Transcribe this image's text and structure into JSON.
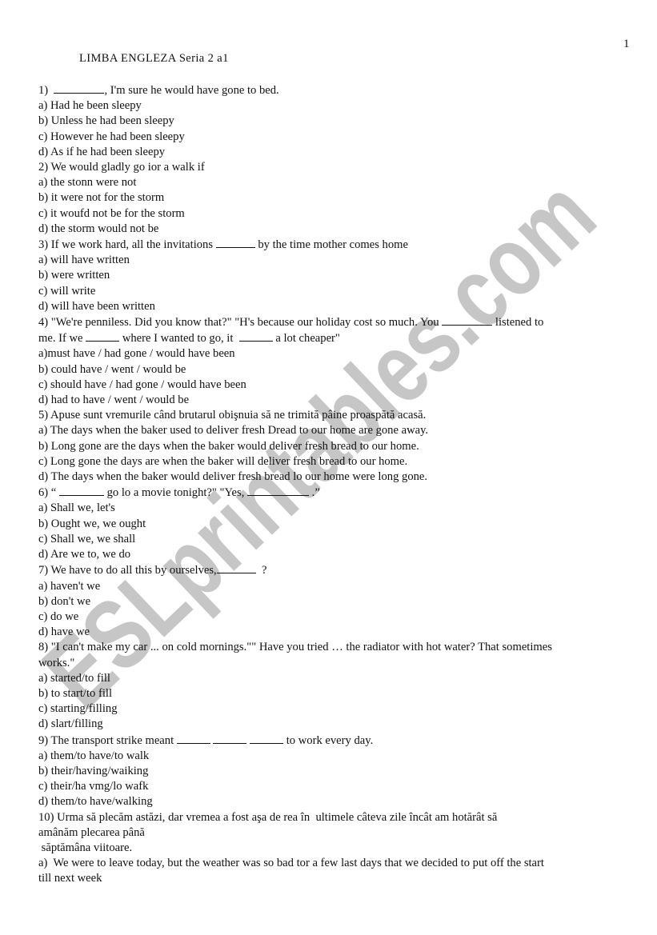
{
  "page": {
    "number": "1",
    "title": "LIMBA ENGLEZA Seria 2 a1",
    "watermark": "ESLprintables.com",
    "watermark_color": "#c6c6c6"
  },
  "questions": [
    {
      "lines": [
        {
          "parts": [
            "1)  ",
            {
              "blank": "_________"
            },
            ", I'm sure he would have gone to bed."
          ]
        }
      ],
      "options": [
        "a) Had he been sleepy",
        "b) Unless he had been sleepy",
        "c) However he had been sleepy",
        "d) As if he had been sleepy"
      ]
    },
    {
      "lines": [
        {
          "parts": [
            "2) We would gladly go ior a walk if"
          ]
        }
      ],
      "options": [
        "a) the stonn were not",
        "b) it were not for the storm",
        "c) it woufd not be for the storm",
        "d) the storm would not be"
      ]
    },
    {
      "lines": [
        {
          "parts": [
            "3) If we work hard, all the invitations ",
            {
              "blank": "_______"
            },
            " by the time mother comes home"
          ]
        }
      ],
      "options": [
        "a) will have written",
        "b) were written",
        "c) will write",
        "d) will have been written"
      ]
    },
    {
      "lines": [
        {
          "parts": [
            "4) \"We're penniless. Did you know that?\" \"H's because our holiday cost so much. You ",
            {
              "blank": "_________"
            },
            " listened to"
          ]
        },
        {
          "parts": [
            "me. If we ",
            {
              "blank": "______"
            },
            " where I wanted to go, it  ",
            {
              "blank": "______"
            },
            " a lot cheaper\""
          ]
        }
      ],
      "options": [
        "a)must have / had gone / would have been",
        "b) could have / went / would be",
        "c) should have / had gone / would have been",
        "d) had to have / went / would be"
      ]
    },
    {
      "lines": [
        {
          "parts": [
            "5) Apuse sunt vremurile când brutarul obişnuia să ne trimită pâine proaspătă acasă."
          ]
        }
      ],
      "options": [
        "a) The days when the baker used to deliver fresh Dread to our home are gone away.",
        "b) Long gone are the days when the baker would deliver fresh bread to our home.",
        "c) Long gone the days are when the baker will deliver fresh bread to our home.",
        "d) The days when the baker would deliver fresh bread lo our home were long gone."
      ]
    },
    {
      "lines": [
        {
          "parts": [
            "6) “ ",
            {
              "blank": "________"
            },
            " go lo a movie tonight?\" \"Yes, ",
            {
              "blank": "___________"
            },
            " .”"
          ]
        }
      ],
      "options": [
        "a) Shall we, let's",
        "b) Ought we, we ought",
        "c) Shall we, we shall",
        "d) Are we to, we do"
      ]
    },
    {
      "lines": [
        {
          "parts": [
            "7) We have to do all this by ourselves,",
            {
              "blank": "_______"
            },
            "  ?"
          ]
        }
      ],
      "options": [
        "a) haven't we",
        "b) don't we",
        "c) do we",
        "d) have we"
      ]
    },
    {
      "lines": [
        {
          "parts": [
            "8) \"I can't make my car ... on cold mornings.\"\" Have you tried … the radiator with hot water? That sometimes"
          ]
        },
        {
          "parts": [
            "works.\""
          ]
        }
      ],
      "options": [
        "a) started/to fill",
        "b) to start/to fill",
        "c) starting/filling",
        "d) slart/filling"
      ]
    },
    {
      "lines": [
        {
          "parts": [
            "9) The transport strike meant ",
            {
              "blank": "______"
            },
            " ",
            {
              "blank": "______"
            },
            " ",
            {
              "blank": "______"
            },
            " to work every day."
          ]
        }
      ],
      "options": [
        "a) them/to have/to walk",
        "b) their/having/waiking",
        "c) their/ha vmg/lo wafk",
        "d) them/to have/walking"
      ]
    },
    {
      "lines": [
        {
          "parts": [
            "10) Urma să plecăm astăzi, dar vremea a fost aşa de rea în  ultimele câteva zile încât am hotărât să"
          ]
        },
        {
          "parts": [
            "amânăm plecarea până"
          ]
        },
        {
          "parts": [
            " săptămâna viitoare."
          ]
        }
      ],
      "options": [
        "a)  We were to leave today, but the weather was so bad tor a few last days that we decided to put off the start",
        "till next week"
      ]
    }
  ]
}
